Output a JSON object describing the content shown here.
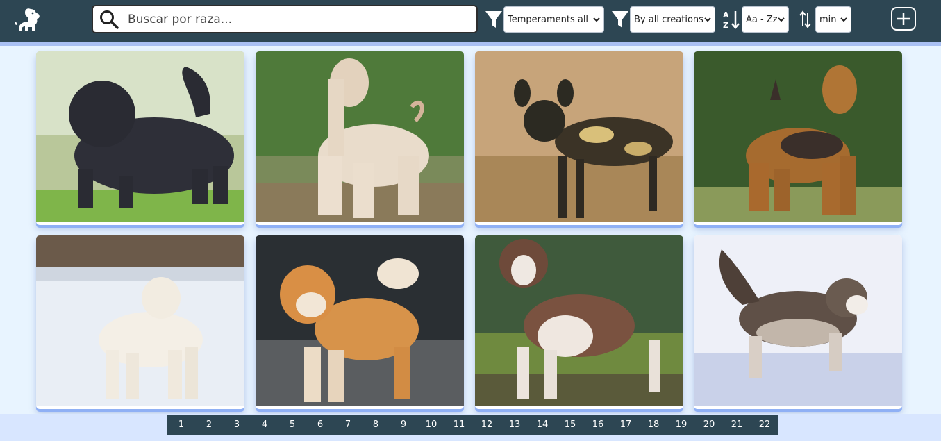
{
  "header": {
    "logo_icon": "dog-logo-icon",
    "search": {
      "placeholder": "Buscar por raza...",
      "value": ""
    },
    "filters": {
      "temperament": {
        "icon": "filter-icon",
        "selected": "Temperaments all"
      },
      "origin": {
        "icon": "filter-icon",
        "selected": "By all creations"
      },
      "name_order": {
        "icon": "sort-alpha-icon",
        "selected": "Aa - Zz"
      },
      "weight_order": {
        "icon": "sort-arrows-icon",
        "selected": "min"
      }
    },
    "add_button_icon": "plus-square-icon"
  },
  "cards": [
    {
      "photo": "black shaggy dog on grass"
    },
    {
      "photo": "cream long-haired dog in field"
    },
    {
      "photo": "spotted wild dog in dry grass"
    },
    {
      "photo": "tan and black terrier near hedge"
    },
    {
      "photo": "white dog in snow"
    },
    {
      "photo": "red and white spitz dog"
    },
    {
      "photo": "brown and white bulldog type"
    },
    {
      "photo": "husky running in snow"
    }
  ],
  "pagination": {
    "pages": [
      "1",
      "2",
      "3",
      "4",
      "5",
      "6",
      "7",
      "8",
      "9",
      "10",
      "11",
      "12",
      "13",
      "14",
      "15",
      "16",
      "17",
      "18",
      "19",
      "20",
      "21",
      "22"
    ]
  },
  "colors": {
    "header_bg": "#2d4653",
    "page_bg": "#e8f4ff",
    "accent_shadow": "#8fb0f5"
  }
}
